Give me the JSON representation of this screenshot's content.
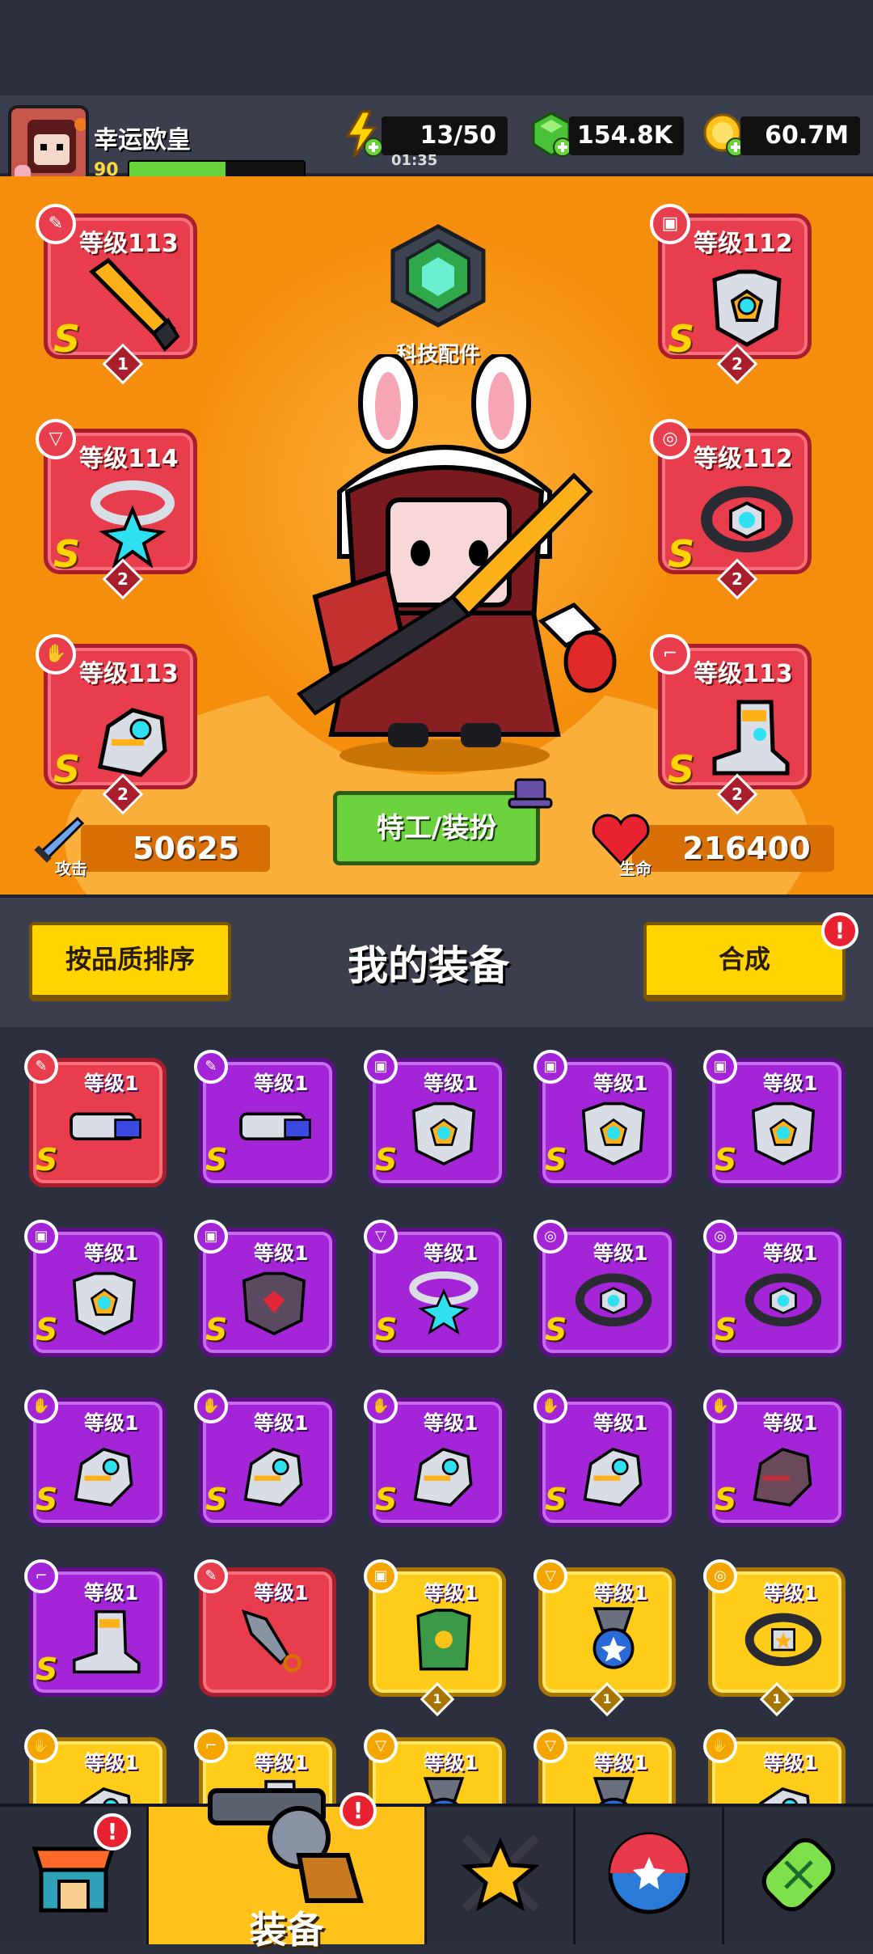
{
  "player": {
    "name": "幸运欧皇",
    "level": "90",
    "xp_fraction": 0.55
  },
  "resources": {
    "energy": {
      "value": "13/50",
      "timer": "01:35",
      "icon": "lightning-icon"
    },
    "gems": {
      "value": "154.8K",
      "icon": "green-gem-icon"
    },
    "gold": {
      "value": "60.7M",
      "icon": "gold-coin-icon"
    }
  },
  "hero": {
    "tech_label": "科技配件",
    "attack": {
      "label": "攻击",
      "value": "50625"
    },
    "life": {
      "label": "生命",
      "value": "216400"
    },
    "costume_button": "特工/装扮",
    "slots": [
      {
        "label": "等级113",
        "grade": "S",
        "rank": "1",
        "icon": "sword-icon"
      },
      {
        "label": "等级112",
        "grade": "S",
        "rank": "2",
        "icon": "armor-icon"
      },
      {
        "label": "等级114",
        "grade": "S",
        "rank": "2",
        "icon": "necklace-icon"
      },
      {
        "label": "等级112",
        "grade": "S",
        "rank": "2",
        "icon": "belt-icon"
      },
      {
        "label": "等级113",
        "grade": "S",
        "rank": "2",
        "icon": "glove-icon"
      },
      {
        "label": "等级113",
        "grade": "S",
        "rank": "2",
        "icon": "boot-icon"
      }
    ]
  },
  "toolbar": {
    "sort_label": "按品质排序",
    "title": "我的装备",
    "merge_label": "合成",
    "merge_alert": "!"
  },
  "inventory": [
    {
      "label": "等级1",
      "grade": "S",
      "color": "red",
      "icon": "gun-icon"
    },
    {
      "label": "等级1",
      "grade": "S",
      "color": "purple",
      "icon": "gun-icon"
    },
    {
      "label": "等级1",
      "grade": "S",
      "color": "purple",
      "icon": "armor-icon"
    },
    {
      "label": "等级1",
      "grade": "S",
      "color": "purple",
      "icon": "armor-icon"
    },
    {
      "label": "等级1",
      "grade": "S",
      "color": "purple",
      "icon": "armor-icon"
    },
    {
      "label": "等级1",
      "grade": "S",
      "color": "purple",
      "icon": "armor-icon"
    },
    {
      "label": "等级1",
      "grade": "S",
      "color": "purple",
      "icon": "dark-armor-icon"
    },
    {
      "label": "等级1",
      "grade": "S",
      "color": "purple",
      "icon": "necklace-icon"
    },
    {
      "label": "等级1",
      "grade": "S",
      "color": "purple",
      "icon": "belt-icon"
    },
    {
      "label": "等级1",
      "grade": "S",
      "color": "purple",
      "icon": "belt-icon"
    },
    {
      "label": "等级1",
      "grade": "S",
      "color": "purple",
      "icon": "glove-icon"
    },
    {
      "label": "等级1",
      "grade": "S",
      "color": "purple",
      "icon": "glove-icon"
    },
    {
      "label": "等级1",
      "grade": "S",
      "color": "purple",
      "icon": "glove-icon"
    },
    {
      "label": "等级1",
      "grade": "S",
      "color": "purple",
      "icon": "glove-icon"
    },
    {
      "label": "等级1",
      "grade": "S",
      "color": "purple",
      "icon": "dark-glove-icon"
    },
    {
      "label": "等级1",
      "grade": "S",
      "color": "purple",
      "icon": "boot-icon"
    },
    {
      "label": "等级1",
      "grade": "",
      "color": "red",
      "icon": "kunai-icon"
    },
    {
      "label": "等级1",
      "grade": "",
      "color": "gold",
      "icon": "vest-icon",
      "rank": "1"
    },
    {
      "label": "等级1",
      "grade": "",
      "color": "gold",
      "icon": "medal-icon",
      "rank": "1"
    },
    {
      "label": "等级1",
      "grade": "",
      "color": "gold",
      "icon": "star-belt-icon",
      "rank": "1"
    },
    {
      "label": "等级1",
      "grade": "",
      "color": "gold",
      "icon": "glove-icon"
    },
    {
      "label": "等级1",
      "grade": "",
      "color": "gold",
      "icon": "boot-icon"
    },
    {
      "label": "等级1",
      "grade": "",
      "color": "gold",
      "icon": "medal-icon"
    },
    {
      "label": "等级1",
      "grade": "",
      "color": "gold",
      "icon": "medal-icon"
    },
    {
      "label": "等级1",
      "grade": "",
      "color": "gold",
      "icon": "glove-icon"
    }
  ],
  "nav": {
    "items": [
      {
        "icon": "shop-icon",
        "label": "",
        "alert": "!"
      },
      {
        "icon": "revolver-icon",
        "label": "装备",
        "alert": "!"
      },
      {
        "icon": "crossed-swords-star-icon",
        "label": ""
      },
      {
        "icon": "planet-ball-icon",
        "label": ""
      },
      {
        "icon": "dna-capsule-icon",
        "label": ""
      }
    ]
  },
  "colors": {
    "red_card": "#e73d4c",
    "purple_card": "#a425d8",
    "gold_card": "#ffcc1a",
    "panel_orange": "#f58d0d",
    "button_yellow": "#ffd400",
    "button_green": "#6bd23e"
  }
}
